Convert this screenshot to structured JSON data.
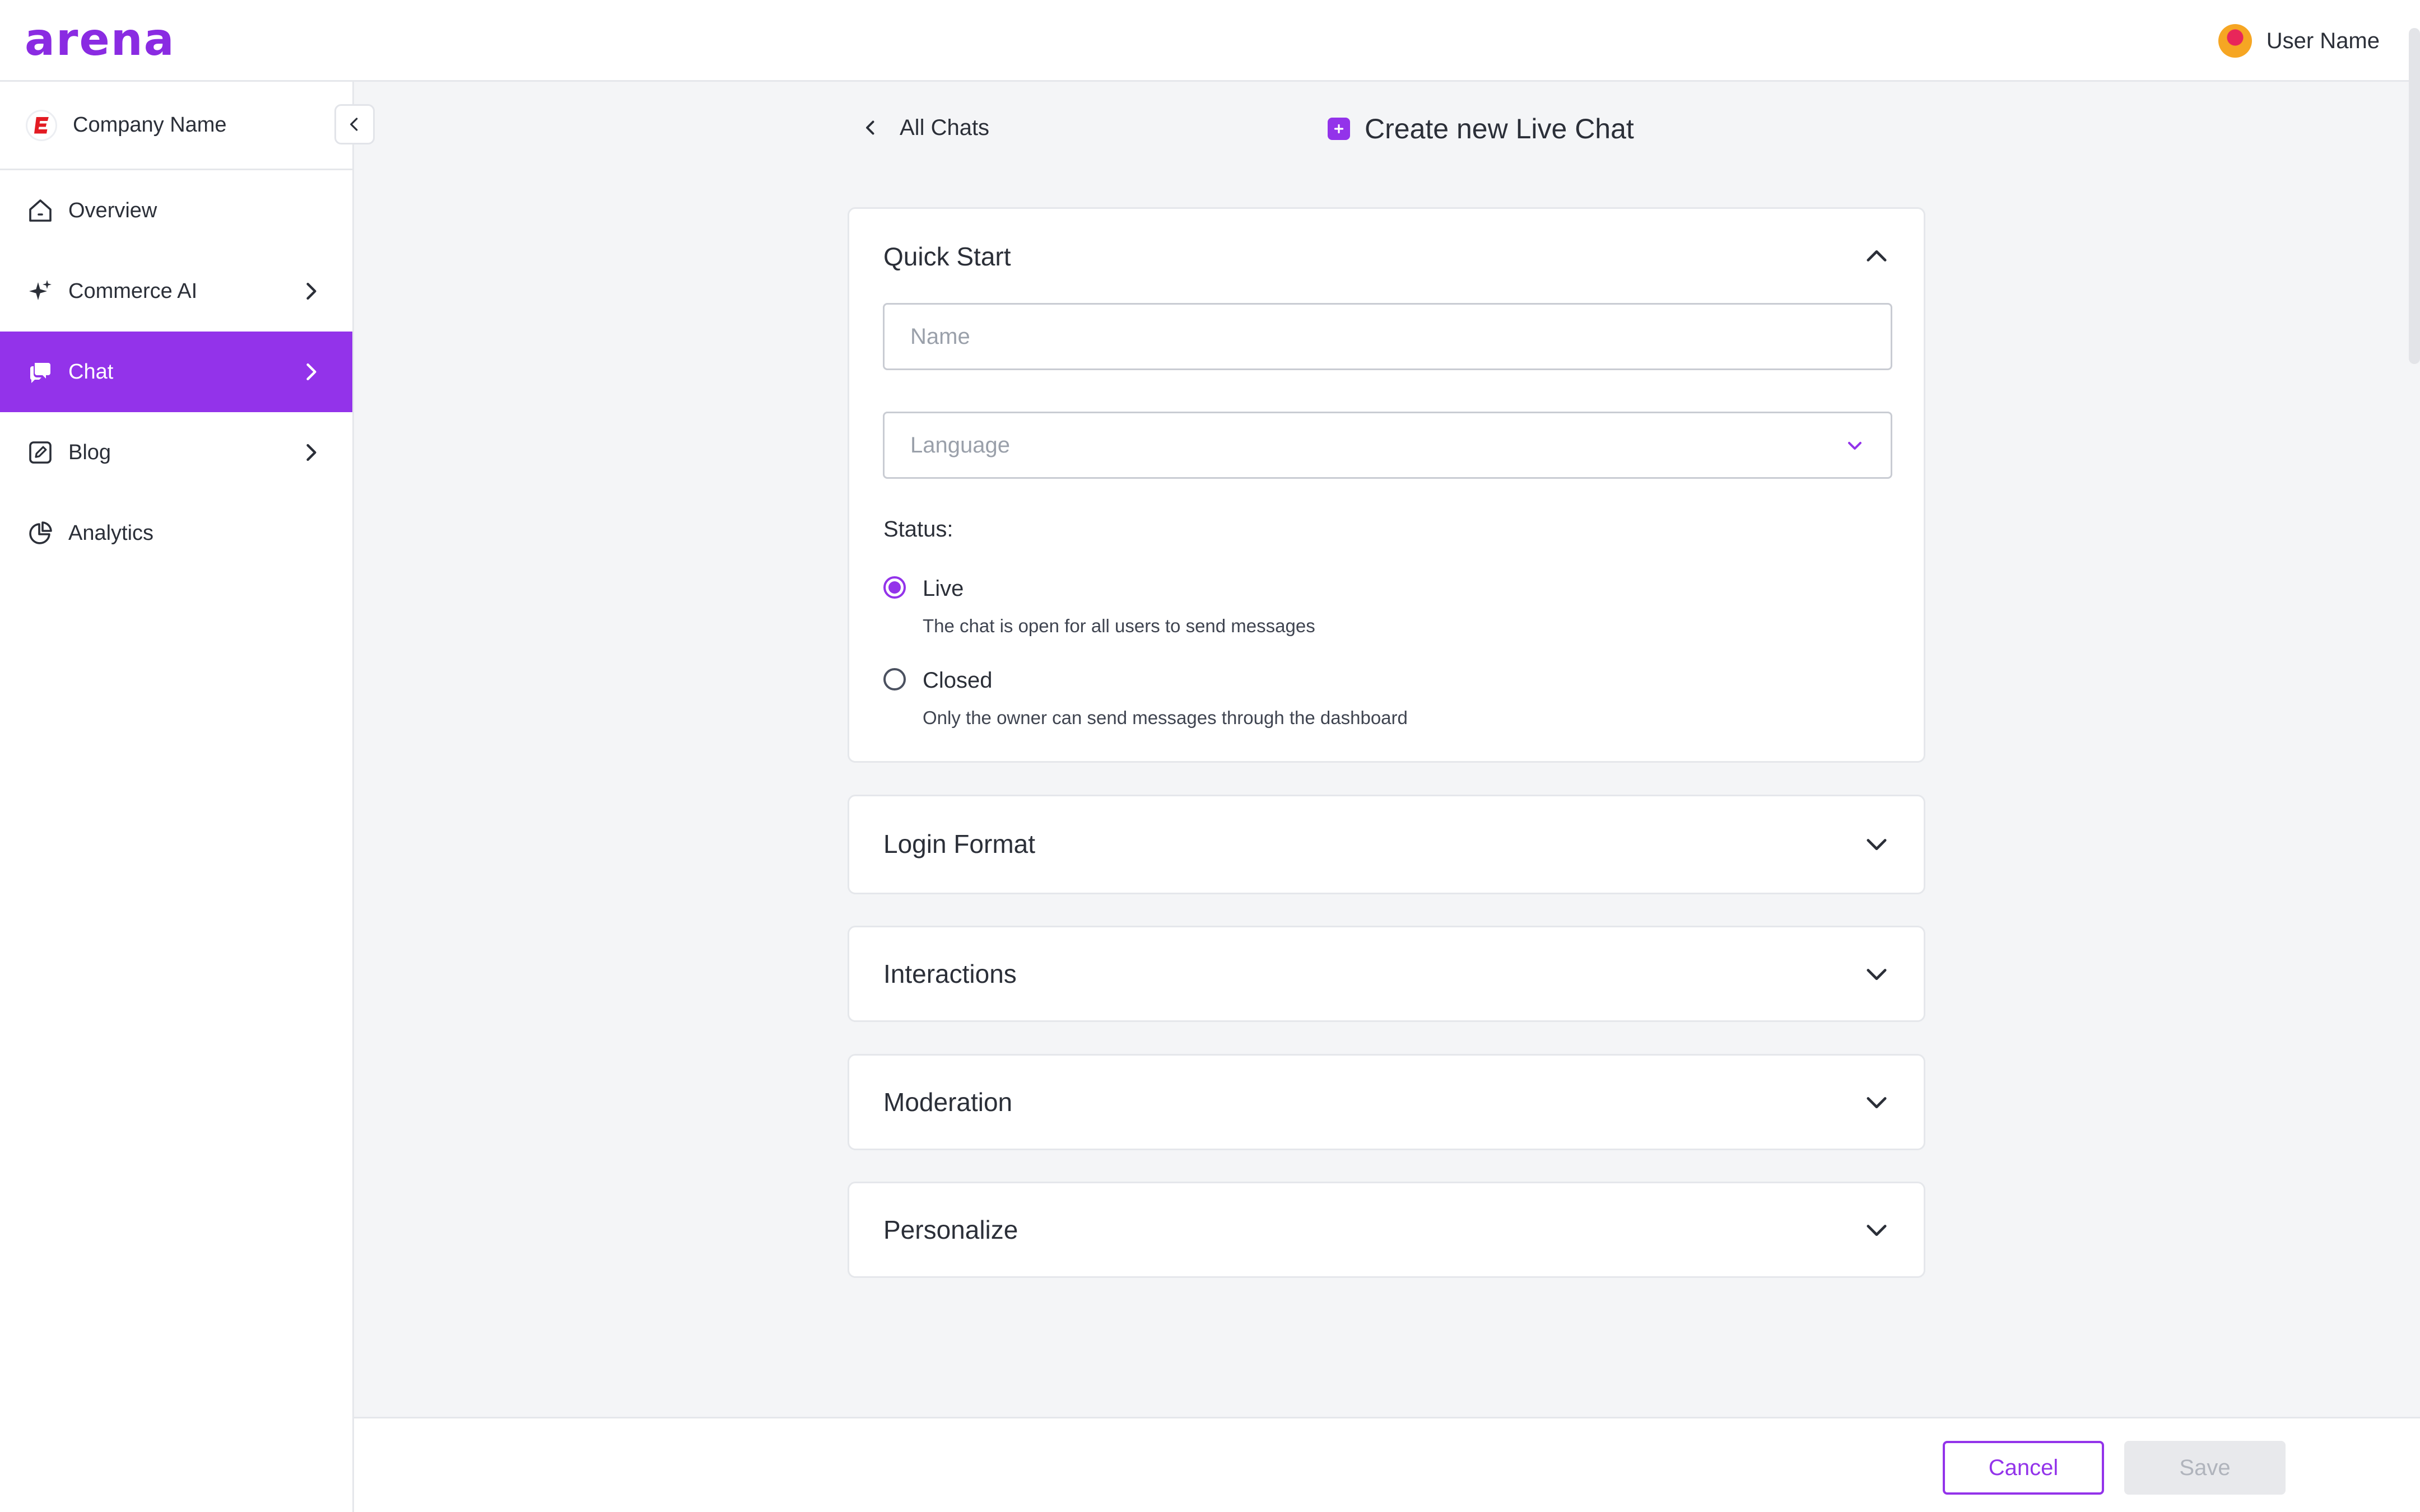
{
  "header": {
    "logo_text": "arena",
    "user_name": "User Name"
  },
  "sidebar": {
    "company_name": "Company Name",
    "items": [
      {
        "label": "Overview",
        "icon": "home-icon",
        "has_chevron": false,
        "active": false
      },
      {
        "label": "Commerce AI",
        "icon": "sparkle-icon",
        "has_chevron": true,
        "active": false
      },
      {
        "label": "Chat",
        "icon": "chat-bubbles-icon",
        "has_chevron": true,
        "active": true
      },
      {
        "label": "Blog",
        "icon": "edit-icon",
        "has_chevron": true,
        "active": false
      },
      {
        "label": "Analytics",
        "icon": "pie-chart-icon",
        "has_chevron": false,
        "active": false
      }
    ]
  },
  "main": {
    "back_label": "All Chats",
    "page_title": "Create new Live Chat",
    "quick_start": {
      "title": "Quick Start",
      "name_placeholder": "Name",
      "name_value": "",
      "language_placeholder": "Language",
      "status_label": "Status:",
      "options": [
        {
          "label": "Live",
          "description": "The chat is open for all users to send messages",
          "checked": true
        },
        {
          "label": "Closed",
          "description": "Only the owner can send messages through the dashboard",
          "checked": false
        }
      ]
    },
    "sections": [
      {
        "title": "Login Format"
      },
      {
        "title": "Interactions"
      },
      {
        "title": "Moderation"
      },
      {
        "title": "Personalize"
      }
    ]
  },
  "footer": {
    "cancel_label": "Cancel",
    "save_label": "Save"
  },
  "colors": {
    "accent": "#9333ea",
    "border": "#e5e7eb",
    "background": "#f4f5f7"
  }
}
